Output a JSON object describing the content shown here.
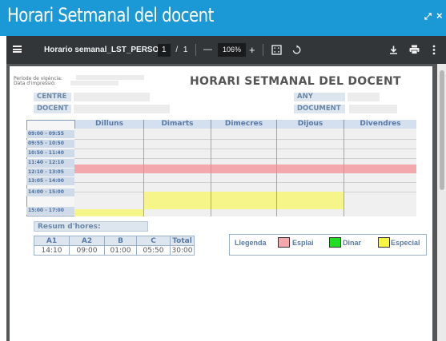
{
  "dialog": {
    "title": "Horari Setmanal del docent",
    "maximize_glyph": "⤢",
    "close_glyph": "×"
  },
  "pdf_toolbar": {
    "file_name": "Horario semanal_LST_PERSO...",
    "current_page": "1",
    "page_separator": "/",
    "total_pages": "1",
    "zoom": "106%",
    "zoom_out_glyph": "—",
    "zoom_in_glyph": "+",
    "icons": [
      "menu-icon",
      "fit-page-icon",
      "rotate-icon",
      "download-icon",
      "print-icon",
      "more-icon"
    ]
  },
  "document": {
    "period_label": "Període de vigència:",
    "print_date_label": "Data d'impressió:",
    "title": "HORARI SETMANAL DEL DOCENT",
    "centre_label": "CENTRE",
    "docent_label": "DOCENT",
    "any_label": "ANY",
    "document_label": "DOCUMENT"
  },
  "schedule": {
    "days": [
      "Dilluns",
      "Dimarts",
      "Dimecres",
      "Dijous",
      "Divendres"
    ],
    "time_slots": [
      "09:00 - 09:55",
      "09:55 - 10:50",
      "10:50 - 11:40",
      "11:40 - 12:10",
      "12:10 - 13:05",
      "13:05 - 14:00",
      "14:00 - 15:00",
      "15:00 - 17:00"
    ]
  },
  "summary": {
    "title": "Resum d'hores:",
    "headers": [
      "A1",
      "A2",
      "B",
      "C",
      "Total"
    ],
    "values": [
      "14:10",
      "09:00",
      "01:00",
      "05:50",
      "30:00"
    ]
  },
  "legend": {
    "title": "Llegenda",
    "items": [
      {
        "label": "Esplai",
        "color": "#f3a8ae"
      },
      {
        "label": "Dinar",
        "color": "#22dd22"
      },
      {
        "label": "Especial",
        "color": "#f6f540"
      }
    ]
  }
}
